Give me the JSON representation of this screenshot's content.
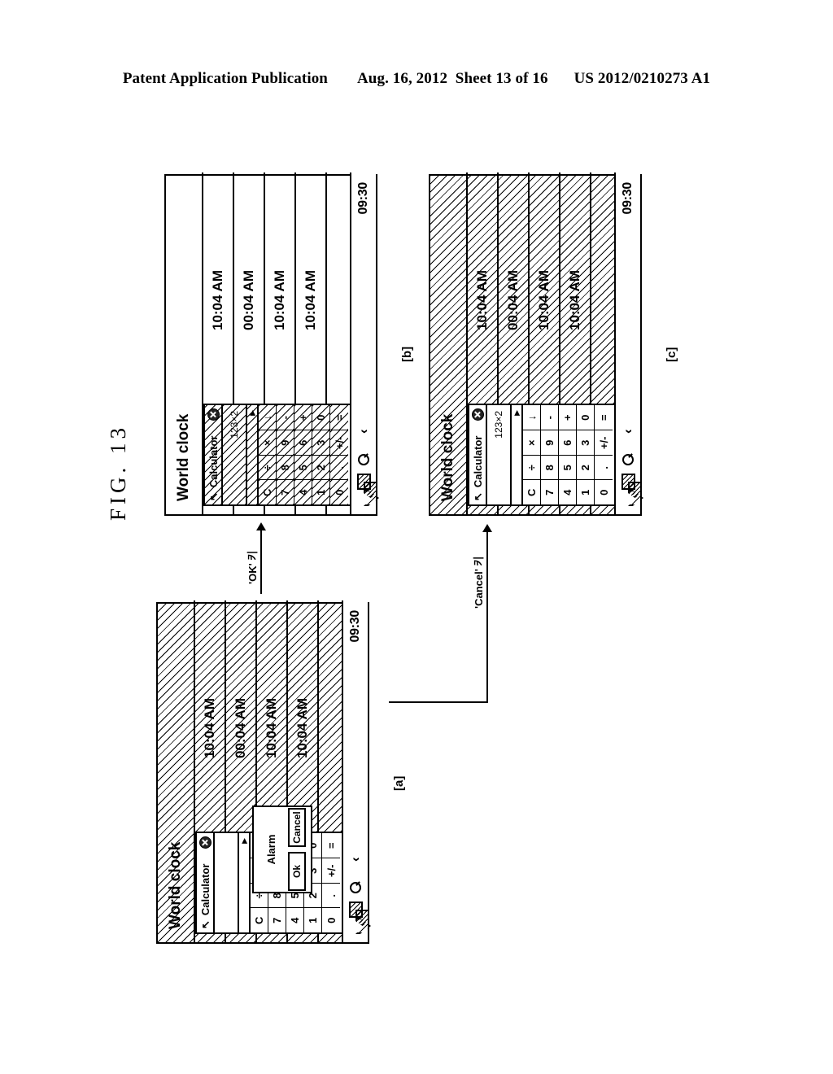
{
  "header": {
    "left": "Patent Application Publication",
    "date": "Aug. 16, 2012",
    "sheet": "Sheet 13 of 16",
    "pubnum": "US 2012/0210273 A1"
  },
  "figure": {
    "label": "FIG. 13"
  },
  "panel_tags": {
    "a": "[a]",
    "b": "[b]",
    "c": "[c]"
  },
  "transitions": {
    "ok_key": "'OK' 키",
    "cancel_key": "'Cancel' 키"
  },
  "screen": {
    "world_clock": {
      "title": "World clock",
      "rows": [
        "10:04 AM",
        "00:04 AM",
        "10:04 AM",
        "10:04 AM"
      ]
    },
    "navbar": {
      "clock": "09:30",
      "caret": "‹",
      "icons": [
        "search-icon",
        "book-icon",
        "back-pentagon-icon",
        "double-chevron-icon"
      ]
    }
  },
  "calculator": {
    "back_icon": "↖",
    "title": "Calculator",
    "close_icon": "close-icon",
    "display": "123×2",
    "sub_marker": "▶",
    "keys": [
      "C",
      "÷",
      "×",
      "↓",
      "7",
      "8",
      "9",
      "-",
      "4",
      "5",
      "6",
      "+",
      "1",
      "2",
      "3",
      "0",
      "0",
      ".",
      "+/-",
      "="
    ]
  },
  "alarm_dialog": {
    "title": "Alarm",
    "ok_label": "Ok",
    "cancel_label": "Cancel"
  }
}
